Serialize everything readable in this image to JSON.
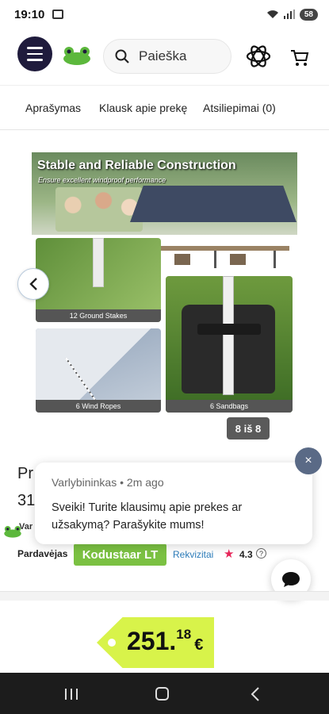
{
  "status_bar": {
    "time": "19:10",
    "battery": "58"
  },
  "header": {
    "search_placeholder": "Paieška"
  },
  "tabs": [
    {
      "label": "Aprašymas"
    },
    {
      "label": "Klausk apie prekę"
    },
    {
      "label": "Atsiliepimai (0)"
    }
  ],
  "gallery": {
    "hero_title": "Stable and Reliable Construction",
    "hero_subtitle": "Ensure excellent windproof performance",
    "tiles": [
      {
        "label": "12 Ground Stakes"
      },
      {
        "label": "6 Wind Ropes"
      },
      {
        "label": "6 Sandbags"
      }
    ],
    "counter": "8 iš 8"
  },
  "product": {
    "title_fragment_1": "Pr",
    "title_fragment_2": "31"
  },
  "chat": {
    "close_label": "×",
    "meta": "Varlybininkas • 2m ago",
    "message": "Sveiki! Turite klausimų apie prekes ar užsakymą? Parašykite mums!"
  },
  "seller": {
    "name_fragment": "Var",
    "label": "Pardavėjas",
    "name": "Kodustaar LT",
    "details_link": "Rekvizitai",
    "rating": "4.3",
    "star": "★",
    "help": "?"
  },
  "price": {
    "integer": "251.",
    "decimals": "18",
    "currency": "€"
  },
  "colors": {
    "brand_dark": "#1f1b3c",
    "seller_green": "#7bc142",
    "price_tag": "#d8f34a",
    "star": "#e8265a"
  }
}
